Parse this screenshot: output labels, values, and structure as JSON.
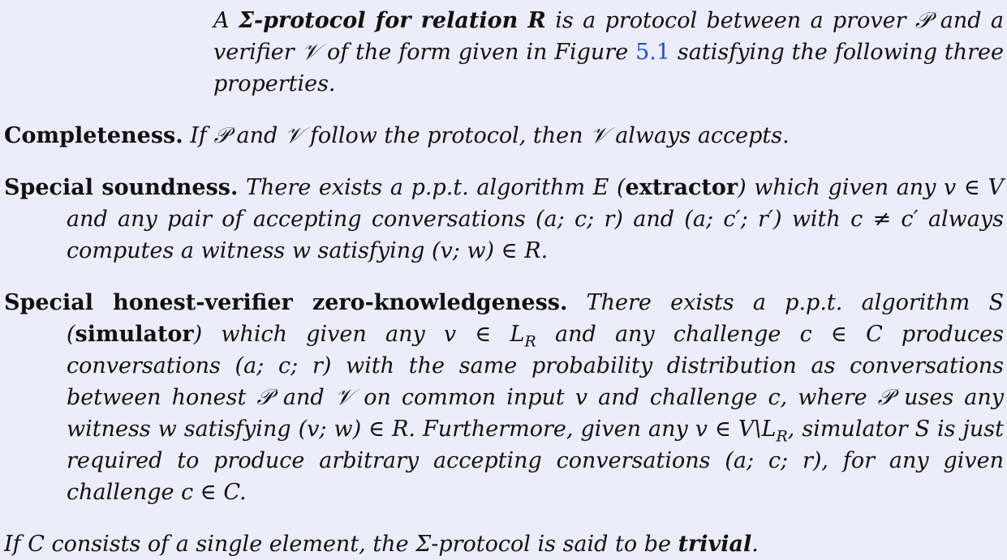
{
  "intro": {
    "lead": "A ",
    "definition": "Σ-protocol for relation R",
    "rest1": " is a protocol between a prover ",
    "prover": "𝒫",
    "rest2": " and a verifier ",
    "verifier": "𝒱",
    "rest3": " of the form given in Figure ",
    "figure_ref": "5.1",
    "rest4": " satisfying the following three properties."
  },
  "completeness": {
    "head": "Completeness.",
    "body": " If 𝒫 and 𝒱 follow the protocol, then 𝒱 always accepts."
  },
  "soundness": {
    "head": "Special soundness.",
    "body1": " There exists a p.p.t. algorithm E (",
    "term": "extractor",
    "body2": ") which given any v ∈ V and any pair of accepting conversations (a; c; r) and (a; c′; r′) with c ≠ c′ always computes a witness w satisfying (v; w) ∈ R."
  },
  "zk": {
    "head": "Special honest-verifier zero-knowledgeness.",
    "body1": " There exists a p.p.t. algorithm S (",
    "term": "simulator",
    "body2": ") which given any v ∈ L",
    "sub1": "R",
    "body3": " and any challenge c ∈ C produces conversations (a; c; r) with the same probability distribution as conversations between honest 𝒫 and 𝒱 on common input v and challenge c, where 𝒫 uses any witness w satisfying (v; w) ∈ R. Furthermore, given any v ∈ V\\L",
    "sub2": "R",
    "body4": ", simulator S is just required to produce arbitrary accepting conversations (a; c; r), for any given challenge c ∈ C."
  },
  "trivial": {
    "body1": "If C consists of a single element, the Σ-protocol is said to be ",
    "term": "trivial",
    "body2": "."
  }
}
